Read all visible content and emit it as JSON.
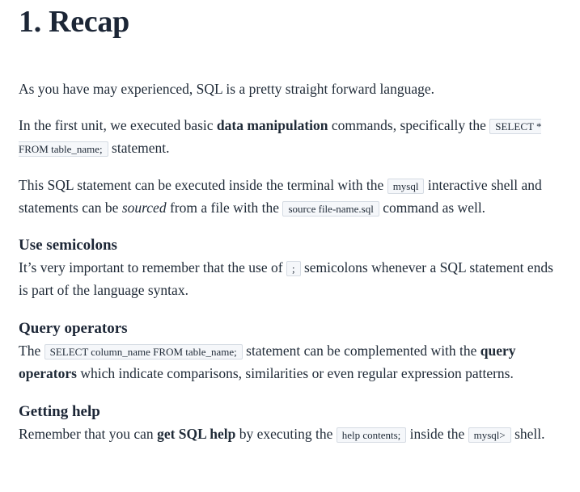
{
  "title": "1. Recap",
  "intro": "As you have may experienced, SQL is a pretty straight forward language.",
  "unit_paragraph": {
    "before": "In the first unit, we executed basic ",
    "bold": "data manipulation",
    "middle": " commands, specifically the ",
    "code": "SELECT * FROM table_name;",
    "after": " statement."
  },
  "terminal_paragraph": {
    "before": "This SQL statement can be executed inside the terminal with the ",
    "code1": "mysql",
    "middle1": " interactive shell and statements can be ",
    "italic": "sourced",
    "middle2": " from a file with the ",
    "code2": "source file-name.sql",
    "after": " command as well."
  },
  "semicolons": {
    "heading": "Use semicolons",
    "before": "It’s very important to remember that the use of ",
    "code": ";",
    "after": " semicolons whenever a SQL statement ends is part of the language syntax."
  },
  "query_operators": {
    "heading": "Query operators",
    "before": "The ",
    "code": "SELECT column_name FROM table_name;",
    "middle": " statement can be complemented with the ",
    "bold": "query operators",
    "after": " which indicate comparisons, similarities or even regular expression patterns."
  },
  "getting_help": {
    "heading": "Getting help",
    "before": "Remember that you can ",
    "bold": "get SQL help",
    "middle1": " by executing the ",
    "code1": "help contents;",
    "middle2": " inside the ",
    "code2": "mysql>",
    "after": " shell."
  }
}
